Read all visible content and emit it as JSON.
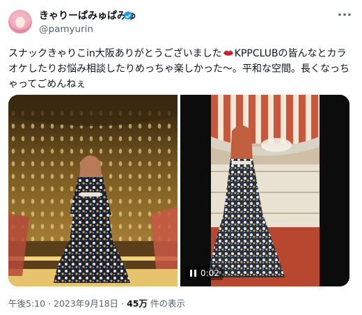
{
  "author": {
    "display_name": "きゃりーぱみゅぱみゅ",
    "handle": "@pamyurin",
    "verified_color": "#1d9bf0"
  },
  "tweet": {
    "text_before_emoji": "スナックきゃりこin大阪ありがとうございました",
    "emoji": "kiss-mark-icon",
    "text_after_emoji": "KPPCLUBの皆んなとカラオケしたりお悩み相談したりめっちゃ楽しかった〜。平和な空間。長くなっちゃってごめんねぇ"
  },
  "media": {
    "items": [
      {
        "kind": "photo"
      },
      {
        "kind": "video",
        "time": "0:02"
      }
    ]
  },
  "meta": {
    "timestamp": "午後5:10 · 2023年9月18日 · ",
    "views_count": "45万",
    "views_label": " 件の表示"
  }
}
